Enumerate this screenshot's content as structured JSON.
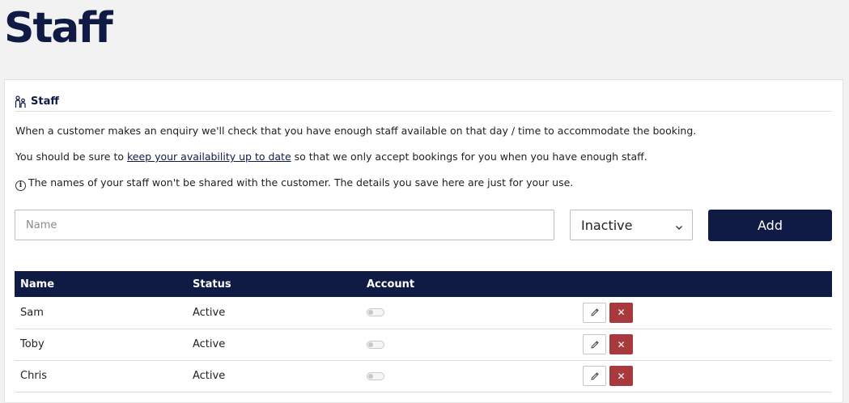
{
  "page": {
    "title": "Staff"
  },
  "card": {
    "title": "Staff",
    "icon": "people-icon",
    "intro": "When a customer makes an enquiry we'll check that you have enough staff available on that day / time to accommodate the booking.",
    "availability": {
      "before": "You should be sure to ",
      "link_text": "keep your availability up to date",
      "after": " so that we only accept bookings for you when you have enough staff."
    },
    "privacy_note": "The names of your staff won't be shared with the customer. The details you save here are just for your use."
  },
  "form": {
    "name_placeholder": "Name",
    "name_value": "",
    "status_selected": "Inactive",
    "add_label": "Add"
  },
  "table": {
    "headers": [
      "Name",
      "Status",
      "Account",
      ""
    ],
    "rows": [
      {
        "name": "Sam",
        "status": "Active",
        "account": false
      },
      {
        "name": "Toby",
        "status": "Active",
        "account": false
      },
      {
        "name": "Chris",
        "status": "Active",
        "account": false
      }
    ],
    "edit_icon": "pencil-icon",
    "delete_icon": "close-icon",
    "delete_glyph": "✕"
  },
  "colors": {
    "brand_navy": "#0f1a45",
    "delete_red": "#a8393d",
    "background": "#f2f2f2"
  }
}
